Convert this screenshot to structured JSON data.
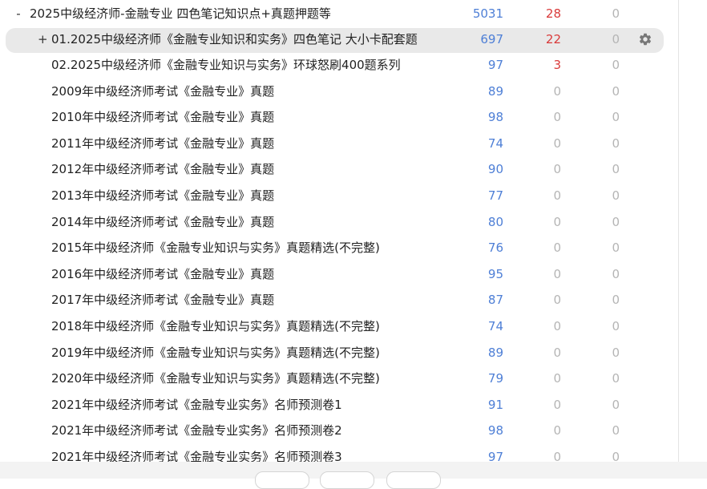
{
  "decks": [
    {
      "expander": "-",
      "name": "2025中级经济师-金融专业 四色笔记知识点+真题押题等",
      "new": "5031",
      "learn": "28",
      "due": "0",
      "depth": 0
    },
    {
      "expander": "+",
      "name": "01.2025中级经济师《金融专业知识和实务》四色笔记 大小卡配套题",
      "new": "697",
      "learn": "22",
      "due": "0",
      "depth": 1,
      "highlighted": true
    },
    {
      "expander": "",
      "name": "02.2025中级经济师《金融专业知识与实务》环球怒刷400题系列",
      "new": "97",
      "learn": "3",
      "due": "0",
      "depth": 1
    },
    {
      "expander": "",
      "name": "2009年中级经济师考试《金融专业》真题",
      "new": "89",
      "learn": "0",
      "due": "0",
      "depth": 1
    },
    {
      "expander": "",
      "name": "2010年中级经济师考试《金融专业》真题",
      "new": "98",
      "learn": "0",
      "due": "0",
      "depth": 1
    },
    {
      "expander": "",
      "name": "2011年中级经济师考试《金融专业》真题",
      "new": "74",
      "learn": "0",
      "due": "0",
      "depth": 1
    },
    {
      "expander": "",
      "name": "2012年中级经济师考试《金融专业》真题",
      "new": "90",
      "learn": "0",
      "due": "0",
      "depth": 1
    },
    {
      "expander": "",
      "name": "2013年中级经济师考试《金融专业》真题",
      "new": "77",
      "learn": "0",
      "due": "0",
      "depth": 1
    },
    {
      "expander": "",
      "name": "2014年中级经济师考试《金融专业》真题",
      "new": "80",
      "learn": "0",
      "due": "0",
      "depth": 1
    },
    {
      "expander": "",
      "name": "2015年中级经济师《金融专业知识与实务》真题精选(不完整)",
      "new": "76",
      "learn": "0",
      "due": "0",
      "depth": 1
    },
    {
      "expander": "",
      "name": "2016年中级经济师考试《金融专业》真题",
      "new": "95",
      "learn": "0",
      "due": "0",
      "depth": 1
    },
    {
      "expander": "",
      "name": "2017年中级经济师考试《金融专业》真题",
      "new": "87",
      "learn": "0",
      "due": "0",
      "depth": 1
    },
    {
      "expander": "",
      "name": "2018年中级经济师《金融专业知识与实务》真题精选(不完整)",
      "new": "74",
      "learn": "0",
      "due": "0",
      "depth": 1
    },
    {
      "expander": "",
      "name": "2019年中级经济师《金融专业知识与实务》真题精选(不完整)",
      "new": "89",
      "learn": "0",
      "due": "0",
      "depth": 1
    },
    {
      "expander": "",
      "name": "2020年中级经济师《金融专业知识与实务》真题精选(不完整)",
      "new": "79",
      "learn": "0",
      "due": "0",
      "depth": 1
    },
    {
      "expander": "",
      "name": "2021年中级经济师考试《金融专业实务》名师预测卷1",
      "new": "91",
      "learn": "0",
      "due": "0",
      "depth": 1
    },
    {
      "expander": "",
      "name": "2021年中级经济师考试《金融专业实务》名师预测卷2",
      "new": "98",
      "learn": "0",
      "due": "0",
      "depth": 1
    },
    {
      "expander": "",
      "name": "2021年中级经济师考试《金融专业实务》名师预测卷3",
      "new": "97",
      "learn": "0",
      "due": "0",
      "depth": 1
    }
  ],
  "icons": {
    "row_options": "gear-icon"
  },
  "colors": {
    "new_count": "#4e7fd6",
    "learn_count": "#d93a3a",
    "zero_count": "#b5b5b5",
    "highlight": "#e9e9e9"
  }
}
